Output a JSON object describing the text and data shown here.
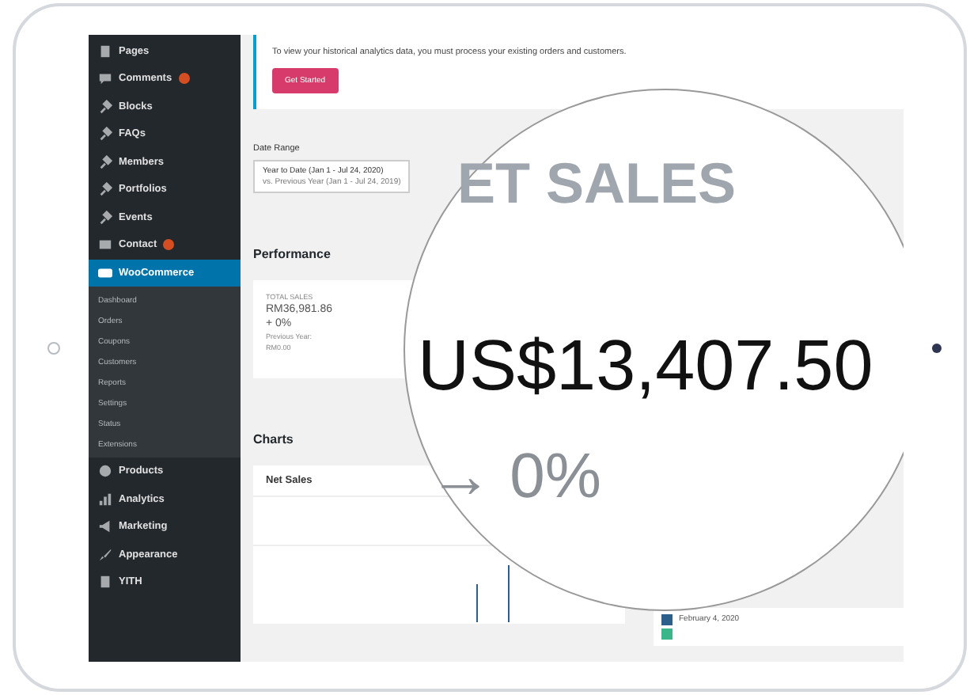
{
  "sidebar": {
    "items": [
      {
        "label": "Pages",
        "badge": false,
        "selected": false
      },
      {
        "label": "Comments",
        "badge": true,
        "selected": false
      },
      {
        "label": "Blocks",
        "badge": false,
        "selected": false
      },
      {
        "label": "FAQs",
        "badge": false,
        "selected": false
      },
      {
        "label": "Members",
        "badge": false,
        "selected": false
      },
      {
        "label": "Portfolios",
        "badge": false,
        "selected": false
      },
      {
        "label": "Events",
        "badge": false,
        "selected": false
      },
      {
        "label": "Contact",
        "badge": true,
        "selected": false
      },
      {
        "label": "WooCommerce",
        "badge": false,
        "selected": true,
        "children": [
          {
            "label": "Dashboard"
          },
          {
            "label": "Orders"
          },
          {
            "label": "Coupons"
          },
          {
            "label": "Customers"
          },
          {
            "label": "Reports"
          },
          {
            "label": "Settings"
          },
          {
            "label": "Status"
          },
          {
            "label": "Extensions"
          }
        ]
      },
      {
        "label": "Products",
        "badge": false,
        "selected": false
      },
      {
        "label": "Analytics",
        "badge": false,
        "selected": false
      },
      {
        "label": "Marketing",
        "badge": false,
        "selected": false
      },
      {
        "label": "Appearance",
        "badge": false,
        "selected": false
      },
      {
        "label": "YITH",
        "badge": false,
        "selected": false
      }
    ]
  },
  "notice": {
    "text": "To view your historical analytics data, you must process your existing orders and customers.",
    "button": "Get Started"
  },
  "date_range": {
    "label": "Date Range",
    "value": "Year to Date (Jan 1 - Jul 24, 2020)",
    "compare": "vs. Previous Year (Jan 1 - Jul 24, 2019)"
  },
  "performance": {
    "title": "Performance",
    "card": {
      "label": "TOTAL SALES",
      "value": "RM36,981.86",
      "delta": "+ 0%",
      "previous_label": "Previous Year:",
      "previous_value": "RM0.00"
    }
  },
  "charts": {
    "title": "Charts",
    "card_title": "Net Sales",
    "legend": [
      {
        "label": "February 4, 2020",
        "color": "#2c5f8a"
      },
      {
        "color": "#3bb58a"
      }
    ]
  },
  "magnifier": {
    "heading": "ET SALES",
    "value": "US$13,407.50",
    "delta": "→ 0%"
  }
}
